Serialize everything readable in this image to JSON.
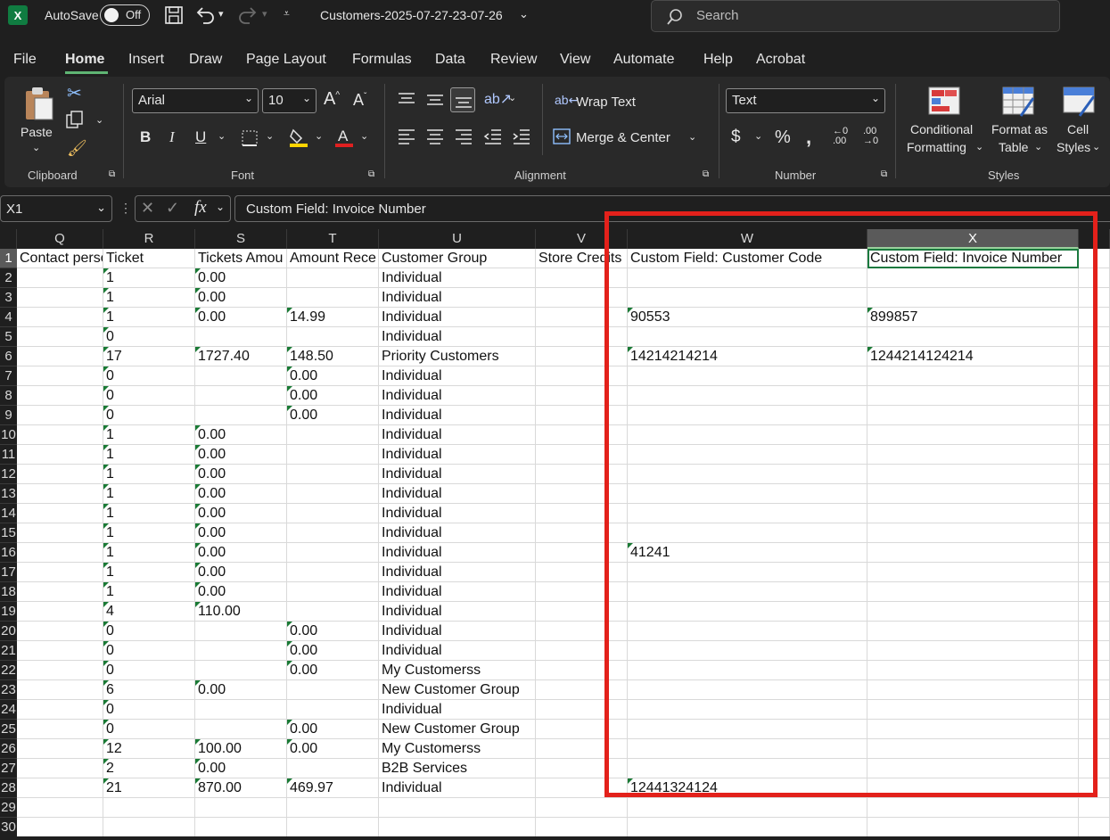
{
  "titlebar": {
    "autosave_label": "AutoSave",
    "autosave_state": "Off",
    "filename": "Customers-2025-07-27-23-07-26",
    "search_placeholder": "Search"
  },
  "menu": [
    "File",
    "Home",
    "Insert",
    "Draw",
    "Page Layout",
    "Formulas",
    "Data",
    "Review",
    "View",
    "Automate",
    "Help",
    "Acrobat"
  ],
  "ribbon": {
    "clipboard": {
      "paste": "Paste",
      "group": "Clipboard"
    },
    "font": {
      "name": "Arial",
      "size": "10",
      "group": "Font",
      "fill_color": "#ffd400",
      "font_color": "#e02020"
    },
    "alignment": {
      "wrap": "Wrap Text",
      "merge": "Merge & Center",
      "group": "Alignment"
    },
    "number": {
      "format": "Text",
      "group": "Number"
    },
    "styles": {
      "conditional": "Conditional",
      "conditional2": "Formatting",
      "format_as": "Format as",
      "format_as2": "Table",
      "cell": "Cell",
      "cell2": "Styles",
      "group": "Styles"
    }
  },
  "formula_bar": {
    "name_box": "X1",
    "formula": "Custom Field: Invoice Number"
  },
  "columns": [
    "Q",
    "R",
    "S",
    "T",
    "U",
    "V",
    "W",
    "X"
  ],
  "header_row": [
    "Contact perso",
    "Ticket",
    "Tickets Amou",
    "Amount Rece",
    "Customer Group",
    "Store Credits",
    "Custom Field: Customer Code",
    "Custom Field: Invoice Number"
  ],
  "rows": [
    [
      "",
      "1",
      "0.00",
      "",
      "Individual",
      "",
      "",
      ""
    ],
    [
      "",
      "1",
      "0.00",
      "",
      "Individual",
      "",
      "",
      ""
    ],
    [
      "",
      "1",
      "0.00",
      "14.99",
      "Individual",
      "",
      "90553",
      "899857"
    ],
    [
      "",
      "0",
      "",
      "",
      "Individual",
      "",
      "",
      ""
    ],
    [
      "",
      "17",
      "1727.40",
      "148.50",
      "Priority Customers",
      "",
      "14214214214",
      "1244214124214"
    ],
    [
      "",
      "0",
      "",
      "0.00",
      "Individual",
      "",
      "",
      ""
    ],
    [
      "",
      "0",
      "",
      "0.00",
      "Individual",
      "",
      "",
      ""
    ],
    [
      "",
      "0",
      "",
      "0.00",
      "Individual",
      "",
      "",
      ""
    ],
    [
      "",
      "1",
      "0.00",
      "",
      "Individual",
      "",
      "",
      ""
    ],
    [
      "",
      "1",
      "0.00",
      "",
      "Individual",
      "",
      "",
      ""
    ],
    [
      "",
      "1",
      "0.00",
      "",
      "Individual",
      "",
      "",
      ""
    ],
    [
      "",
      "1",
      "0.00",
      "",
      "Individual",
      "",
      "",
      ""
    ],
    [
      "",
      "1",
      "0.00",
      "",
      "Individual",
      "",
      "",
      ""
    ],
    [
      "",
      "1",
      "0.00",
      "",
      "Individual",
      "",
      "",
      ""
    ],
    [
      "",
      "1",
      "0.00",
      "",
      "Individual",
      "",
      "41241",
      ""
    ],
    [
      "",
      "1",
      "0.00",
      "",
      "Individual",
      "",
      "",
      ""
    ],
    [
      "",
      "1",
      "0.00",
      "",
      "Individual",
      "",
      "",
      ""
    ],
    [
      "",
      "4",
      "110.00",
      "",
      "Individual",
      "",
      "",
      ""
    ],
    [
      "",
      "0",
      "",
      "0.00",
      "Individual",
      "",
      "",
      ""
    ],
    [
      "",
      "0",
      "",
      "0.00",
      "Individual",
      "",
      "",
      ""
    ],
    [
      "",
      "0",
      "",
      "0.00",
      "My Customerss",
      "",
      "",
      ""
    ],
    [
      "",
      "6",
      "0.00",
      "",
      "New Customer Group",
      "",
      "",
      ""
    ],
    [
      "",
      "0",
      "",
      "",
      "Individual",
      "",
      "",
      ""
    ],
    [
      "",
      "0",
      "",
      "0.00",
      "New Customer Group",
      "",
      "",
      ""
    ],
    [
      "",
      "12",
      "100.00",
      "0.00",
      "My Customerss",
      "",
      "",
      ""
    ],
    [
      "",
      "2",
      "0.00",
      "",
      "B2B Services",
      "",
      "",
      ""
    ],
    [
      "",
      "21",
      "870.00",
      "469.97",
      "Individual",
      "",
      "12441324124",
      ""
    ],
    [
      "",
      "",
      "",
      "",
      "",
      "",
      "",
      ""
    ],
    [
      "",
      "",
      "",
      "",
      "",
      "",
      "",
      ""
    ]
  ],
  "highlight_color": "#e3211b"
}
